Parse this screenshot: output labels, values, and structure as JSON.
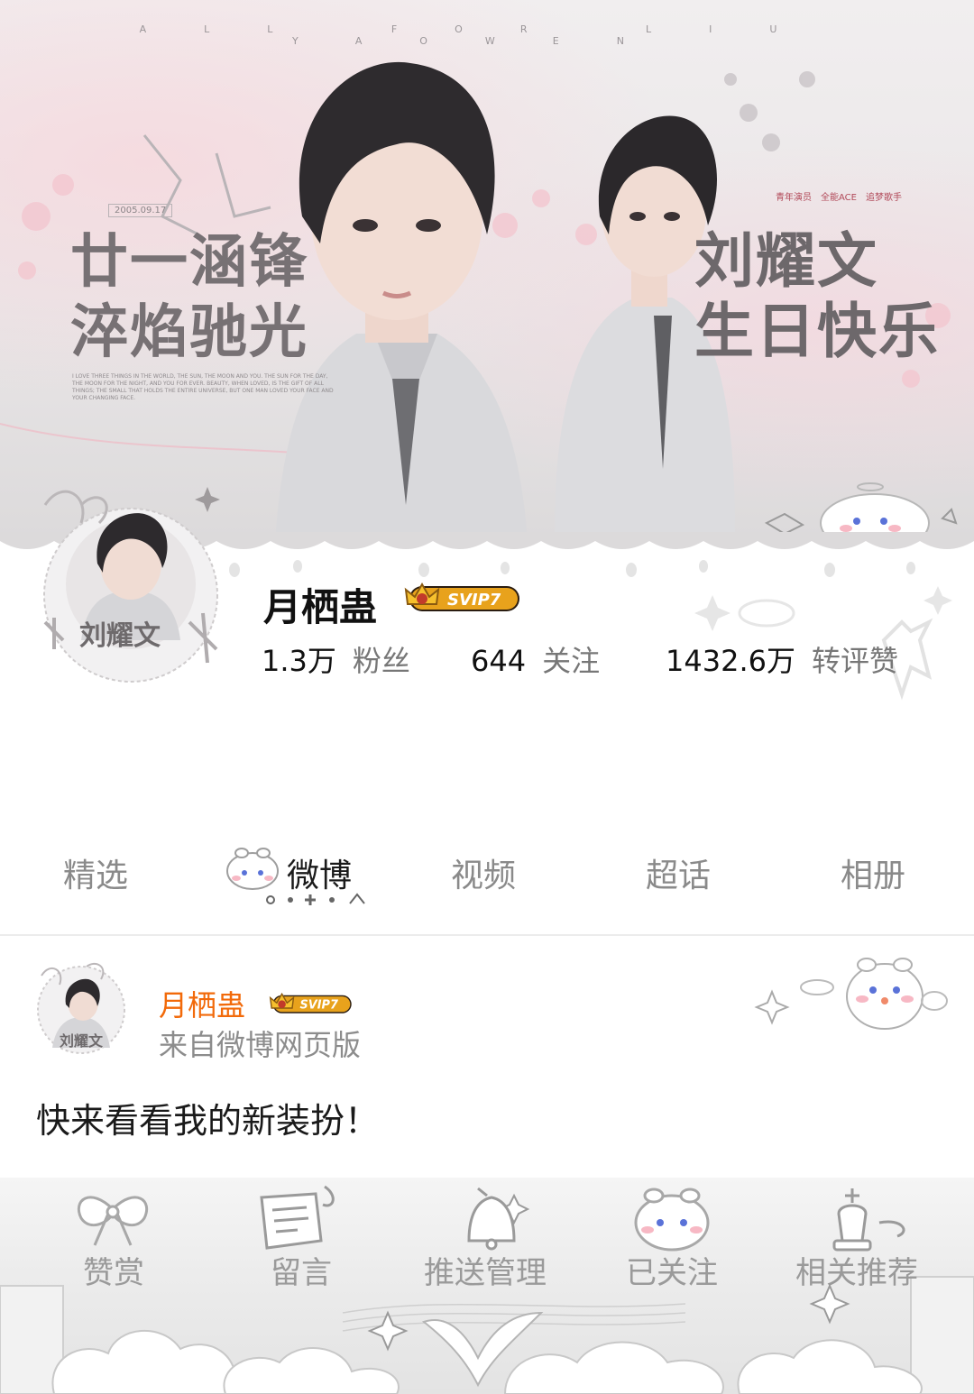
{
  "banner": {
    "watermark": "ALL FOR LIU YAOWEN",
    "left_text_line1": "廿一涵锋",
    "left_text_line2": "淬焰驰光",
    "right_text_line1": "刘耀文",
    "right_text_line2": "生日快乐",
    "date": "2005.09.17",
    "tags": [
      "青年演员",
      "全能ACE",
      "追梦歌手"
    ],
    "small_text": "I love three things in the world, the sun, the moon and you. The sun for the day, the moon for the night, and you for ever. Beauty, when loved, is the gift of all things; the small that holds the entire universe, but one man loved your face and your changing face."
  },
  "profile": {
    "avatar_caption": "刘耀文",
    "username": "月栖蛊",
    "badge": "SVIP7",
    "stats": [
      {
        "value": "1.3万",
        "label": "粉丝"
      },
      {
        "value": "644",
        "label": "关注"
      },
      {
        "value": "1432.6万",
        "label": "转评赞"
      }
    ]
  },
  "tabs": [
    {
      "label": "精选",
      "active": false
    },
    {
      "label": "微博",
      "active": true
    },
    {
      "label": "视频",
      "active": false
    },
    {
      "label": "超话",
      "active": false
    },
    {
      "label": "相册",
      "active": false
    }
  ],
  "post": {
    "author": "月栖蛊",
    "badge": "SVIP7",
    "source": "来自微博网页版",
    "text": "快来看看我的新装扮！"
  },
  "actions": [
    {
      "label": "赞赏",
      "icon": "ribbon-bow-icon"
    },
    {
      "label": "留言",
      "icon": "note-paper-icon"
    },
    {
      "label": "推送管理",
      "icon": "bell-icon"
    },
    {
      "label": "已关注",
      "icon": "bunny-mascot-icon"
    },
    {
      "label": "相关推荐",
      "icon": "chess-king-icon"
    }
  ],
  "colors": {
    "username_accent": "#f26a0a",
    "badge_gold": "#e8a21c",
    "tab_active": "#1a1a1a",
    "tab_inactive": "#8a8a8a"
  }
}
